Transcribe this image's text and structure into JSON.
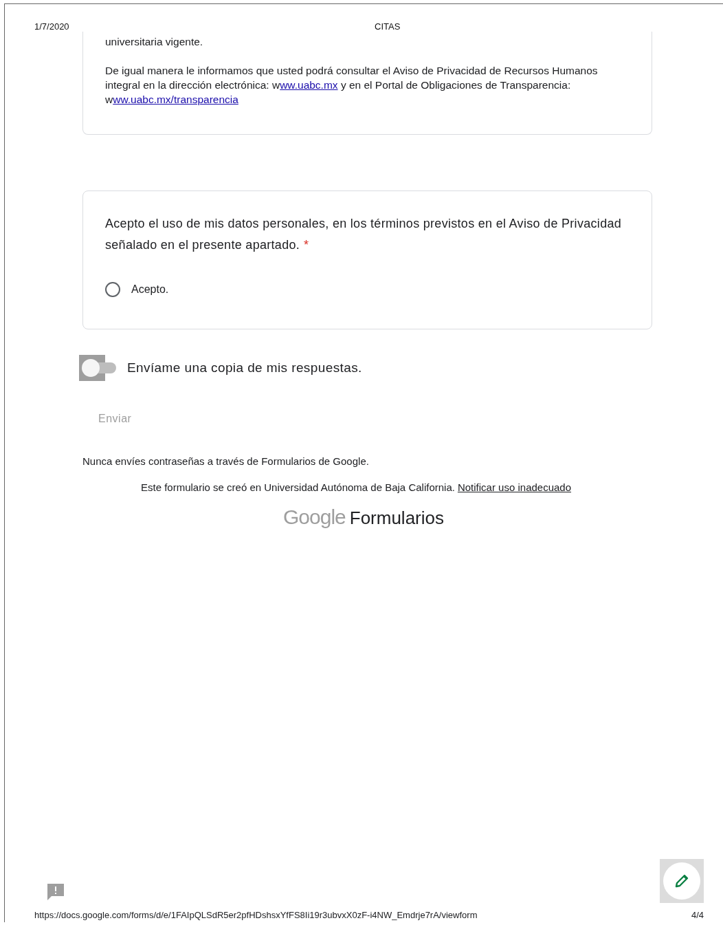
{
  "print_header": {
    "date": "1/7/2020",
    "title": "CITAS"
  },
  "notice": {
    "paragraphs": [
      [
        {
          "kind": "text",
          "text": "universitaria vigente."
        }
      ],
      [
        {
          "kind": "text",
          "text": "De igual manera le informamos que usted podrá consultar el Aviso de Privacidad de Recursos Humanos integral en la dirección electrónica: w"
        },
        {
          "kind": "link",
          "text": "ww.uabc.mx"
        },
        {
          "kind": "text",
          "text": " y en el Portal de Obligaciones de Transparencia: w"
        },
        {
          "kind": "link",
          "text": "ww.uabc.mx/transparencia"
        }
      ]
    ]
  },
  "question": {
    "text": "Acepto el uso de mis datos personales, en los términos previstos en el Aviso de Privacidad señalado en el presente apartado.",
    "required_mark": "*",
    "options": [
      {
        "label": "Acepto.",
        "selected": false
      }
    ]
  },
  "copy_toggle": {
    "label": "Envíame una copia de mis respuestas.",
    "on": false
  },
  "submit": {
    "label": "Enviar",
    "disabled": true
  },
  "footer": {
    "warning": "Nunca envíes contraseñas a través de Formularios de Google.",
    "created_by": "Este formulario se creó en Universidad Autónoma de Baja California.",
    "report_link": "Notificar uso inadecuado",
    "logo": {
      "brand": "Google",
      "product": "Formularios"
    }
  },
  "print_footer": {
    "url": "https://docs.google.com/forms/d/e/1FAIpQLSdR5er2pfHDshsxYfFS8Ii19r3ubvxX0zF-i4NW_Emdrje7rA/viewform",
    "page": "4/4"
  }
}
